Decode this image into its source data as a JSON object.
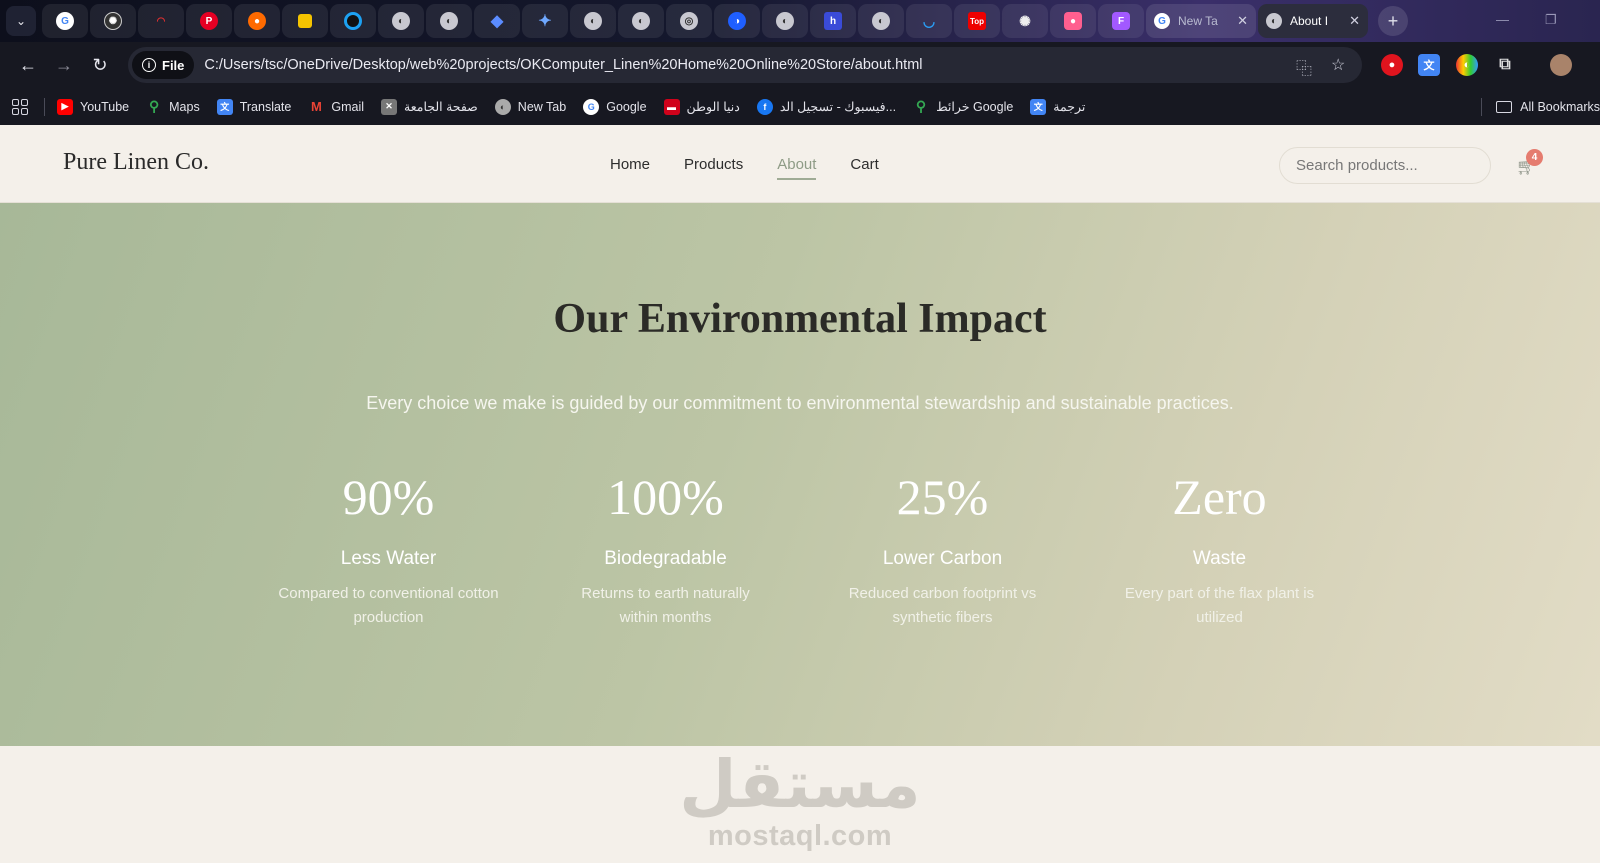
{
  "browser": {
    "tabs": [
      {
        "icon": "google-icon",
        "label": "New Ta"
      },
      {
        "icon": "globe-icon",
        "label": "About I"
      }
    ],
    "url": "C:/Users/tsc/OneDrive/Desktop/web%20projects/OKComputer_Linen%20Home%20Online%20Store/about.html",
    "site_chip": "File",
    "bookmarks": [
      {
        "label": "YouTube",
        "icon": "youtube-icon",
        "color": "#ff0000"
      },
      {
        "label": "Maps",
        "icon": "maps-icon",
        "color": "#34a853"
      },
      {
        "label": "Translate",
        "icon": "translate-icon",
        "color": "#4285f4"
      },
      {
        "label": "Gmail",
        "icon": "gmail-icon",
        "color": "#ea4335"
      },
      {
        "label": "صفحة الجامعة",
        "icon": "university-icon",
        "color": "#888888"
      },
      {
        "label": "New Tab",
        "icon": "globe-icon",
        "color": "#999999"
      },
      {
        "label": "Google",
        "icon": "google-icon",
        "color": "#4285f4"
      },
      {
        "label": "دنيا الوطن",
        "icon": "news-icon",
        "color": "#d0021b"
      },
      {
        "label": "فيسبوك - تسجيل الد...",
        "icon": "facebook-icon",
        "color": "#1877f2"
      },
      {
        "label": "خرائط Google",
        "icon": "maps-icon",
        "color": "#34a853"
      },
      {
        "label": "ترجمة",
        "icon": "translate-icon",
        "color": "#4285f4"
      }
    ],
    "all_bookmarks": "All Bookmarks"
  },
  "header": {
    "logo": "Pure Linen Co.",
    "nav": [
      "Home",
      "Products",
      "About",
      "Cart"
    ],
    "active_nav": "About",
    "search_placeholder": "Search products...",
    "cart_count": "4"
  },
  "impact": {
    "title": "Our Environmental Impact",
    "subtitle": "Every choice we make is guided by our commitment to environmental stewardship and sustainable practices.",
    "stats": [
      {
        "value": "90%",
        "label": "Less Water",
        "desc": "Compared to conventional cotton production"
      },
      {
        "value": "100%",
        "label": "Biodegradable",
        "desc": "Returns to earth naturally within months"
      },
      {
        "value": "25%",
        "label": "Lower Carbon",
        "desc": "Reduced carbon footprint vs synthetic fibers"
      },
      {
        "value": "Zero",
        "label": "Waste",
        "desc": "Every part of the flax plant is utilized"
      }
    ]
  },
  "watermark": {
    "arabic": "مستقل",
    "latin": "mostaql.com"
  }
}
